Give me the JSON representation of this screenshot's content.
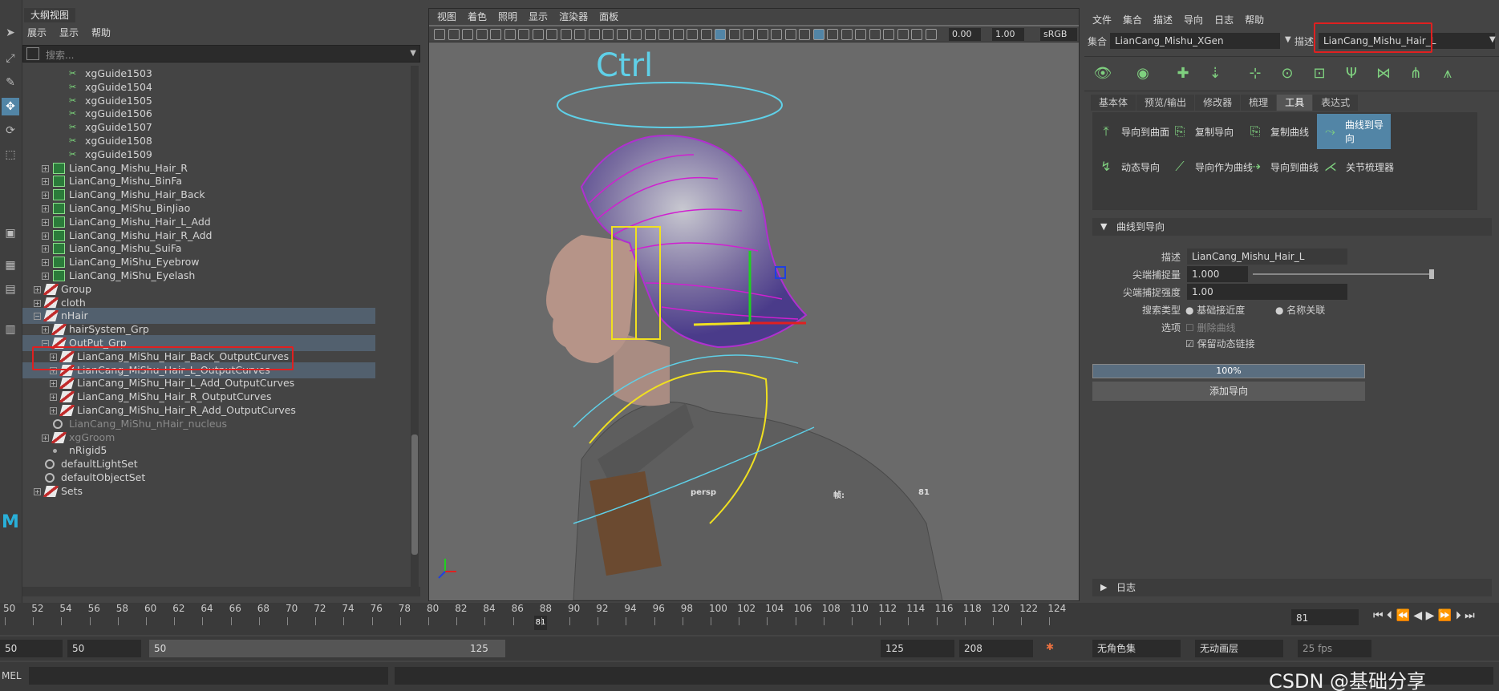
{
  "outliner": {
    "tab": "大纲视图",
    "menu": [
      "展示",
      "显示",
      "帮助"
    ],
    "search_placeholder": "搜索...",
    "rows": [
      {
        "label": "xgGuide1503",
        "type": "curve",
        "depth": 4
      },
      {
        "label": "xgGuide1504",
        "type": "curve",
        "depth": 4
      },
      {
        "label": "xgGuide1505",
        "type": "curve",
        "depth": 4
      },
      {
        "label": "xgGuide1506",
        "type": "curve",
        "depth": 4
      },
      {
        "label": "xgGuide1507",
        "type": "curve",
        "depth": 4
      },
      {
        "label": "xgGuide1508",
        "type": "curve",
        "depth": 4
      },
      {
        "label": "xgGuide1509",
        "type": "curve",
        "depth": 4
      },
      {
        "label": "LianCang_Mishu_Hair_R",
        "type": "xg",
        "depth": 2
      },
      {
        "label": "LianCang_Mishu_BinFa",
        "type": "xg",
        "depth": 2
      },
      {
        "label": "LianCang_Mishu_Hair_Back",
        "type": "xg",
        "depth": 2
      },
      {
        "label": "LianCang_MiShu_BinJiao",
        "type": "xg",
        "depth": 2
      },
      {
        "label": "LianCang_Mishu_Hair_L_Add",
        "type": "xg",
        "depth": 2
      },
      {
        "label": "LianCang_Mishu_Hair_R_Add",
        "type": "xg",
        "depth": 2
      },
      {
        "label": "LianCang_Mishu_SuiFa",
        "type": "xg",
        "depth": 2
      },
      {
        "label": "LianCang_MiShu_Eyebrow",
        "type": "xg",
        "depth": 2
      },
      {
        "label": "LianCang_MiShu_Eyelash",
        "type": "xg",
        "depth": 2
      },
      {
        "label": "Group",
        "type": "grp",
        "depth": 1
      },
      {
        "label": "cloth",
        "type": "grp",
        "depth": 1
      },
      {
        "label": "nHair",
        "type": "grp",
        "depth": 1,
        "highlight": true,
        "open": true
      },
      {
        "label": "hairSystem_Grp",
        "type": "grp",
        "depth": 2
      },
      {
        "label": "OutPut_Grp",
        "type": "grp",
        "depth": 2,
        "highlight": true,
        "open": true
      },
      {
        "label": "LianCang_MiShu_Hair_Back_OutputCurves",
        "type": "grp",
        "depth": 3
      },
      {
        "label": "LianCang_MiShu_Hair_L_OutputCurves",
        "type": "grp",
        "depth": 3,
        "highlight": true
      },
      {
        "label": "LianCang_MiShu_Hair_L_Add_OutputCurves",
        "type": "grp",
        "depth": 3
      },
      {
        "label": "LianCang_MiShu_Hair_R_OutputCurves",
        "type": "grp",
        "depth": 3
      },
      {
        "label": "LianCang_MiShu_Hair_R_Add_OutputCurves",
        "type": "grp",
        "depth": 3
      },
      {
        "label": "LianCang_MiShu_nHair_nucleus",
        "type": "set",
        "depth": 2,
        "dim": true
      },
      {
        "label": "xgGroom",
        "type": "grp",
        "depth": 2,
        "dim": true
      },
      {
        "label": "nRigid5",
        "type": "dot",
        "depth": 2
      },
      {
        "label": "defaultLightSet",
        "type": "set",
        "depth": 1
      },
      {
        "label": "defaultObjectSet",
        "type": "set",
        "depth": 1
      },
      {
        "label": "Sets",
        "type": "grp",
        "depth": 1
      }
    ]
  },
  "viewport": {
    "menu": [
      "视图",
      "着色",
      "照明",
      "显示",
      "渲染器",
      "面板"
    ],
    "val1": "0.00",
    "val2": "1.00",
    "colorspace": "sRGB",
    "camera": "persp",
    "frame_label": "帧:",
    "frame": "81"
  },
  "xgen": {
    "menu": [
      "文件",
      "集合",
      "描述",
      "导向",
      "日志",
      "帮助"
    ],
    "collection_label": "集合",
    "collection": "LianCang_Mishu_XGen",
    "description_label": "描述",
    "description": "LianCang_Mishu_Hair_L",
    "tabs": [
      "基本体",
      "预览/输出",
      "修改器",
      "梳理",
      "工具",
      "表达式"
    ],
    "tools": [
      "导向到曲面",
      "复制导向",
      "复制曲线",
      "曲线到导向",
      "动态导向",
      "导向作为曲线",
      "导向到曲线",
      "关节梳理器"
    ],
    "section": "曲线到导向",
    "desc_field_label": "描述",
    "desc_field": "LianCang_Mishu_Hair_L",
    "snap_amount_label": "尖端捕捉量",
    "snap_amount": "1.000",
    "snap_strength_label": "尖端捕捉强度",
    "snap_strength": "1.00",
    "search_type_label": "搜索类型",
    "search_opt1": "基础接近度",
    "search_opt2": "名称关联",
    "options_label": "选项",
    "delete_curves": "删除曲线",
    "keep_dynamic": "保留动态链接",
    "progress": "100%",
    "add_button": "添加导向",
    "log": "日志"
  },
  "timeline": {
    "ticks": [
      "50",
      "52",
      "54",
      "56",
      "58",
      "60",
      "62",
      "64",
      "66",
      "68",
      "70",
      "72",
      "74",
      "76",
      "78",
      "80",
      "82",
      "84",
      "86",
      "88",
      "90",
      "92",
      "94",
      "96",
      "98",
      "100",
      "102",
      "104",
      "106",
      "108",
      "110",
      "112",
      "114",
      "116",
      "118",
      "120",
      "122",
      "124"
    ],
    "current": "81",
    "current_field": "81"
  },
  "range": {
    "start_outer": "50",
    "start_inner": "50",
    "slider_start": "50",
    "slider_end": "125",
    "end_inner": "125",
    "end_outer": "208",
    "charset": "无角色集",
    "anim_layer": "无动画层",
    "fps": "25 fps"
  },
  "mel": {
    "label": "MEL"
  },
  "watermark": "CSDN @基础分享"
}
